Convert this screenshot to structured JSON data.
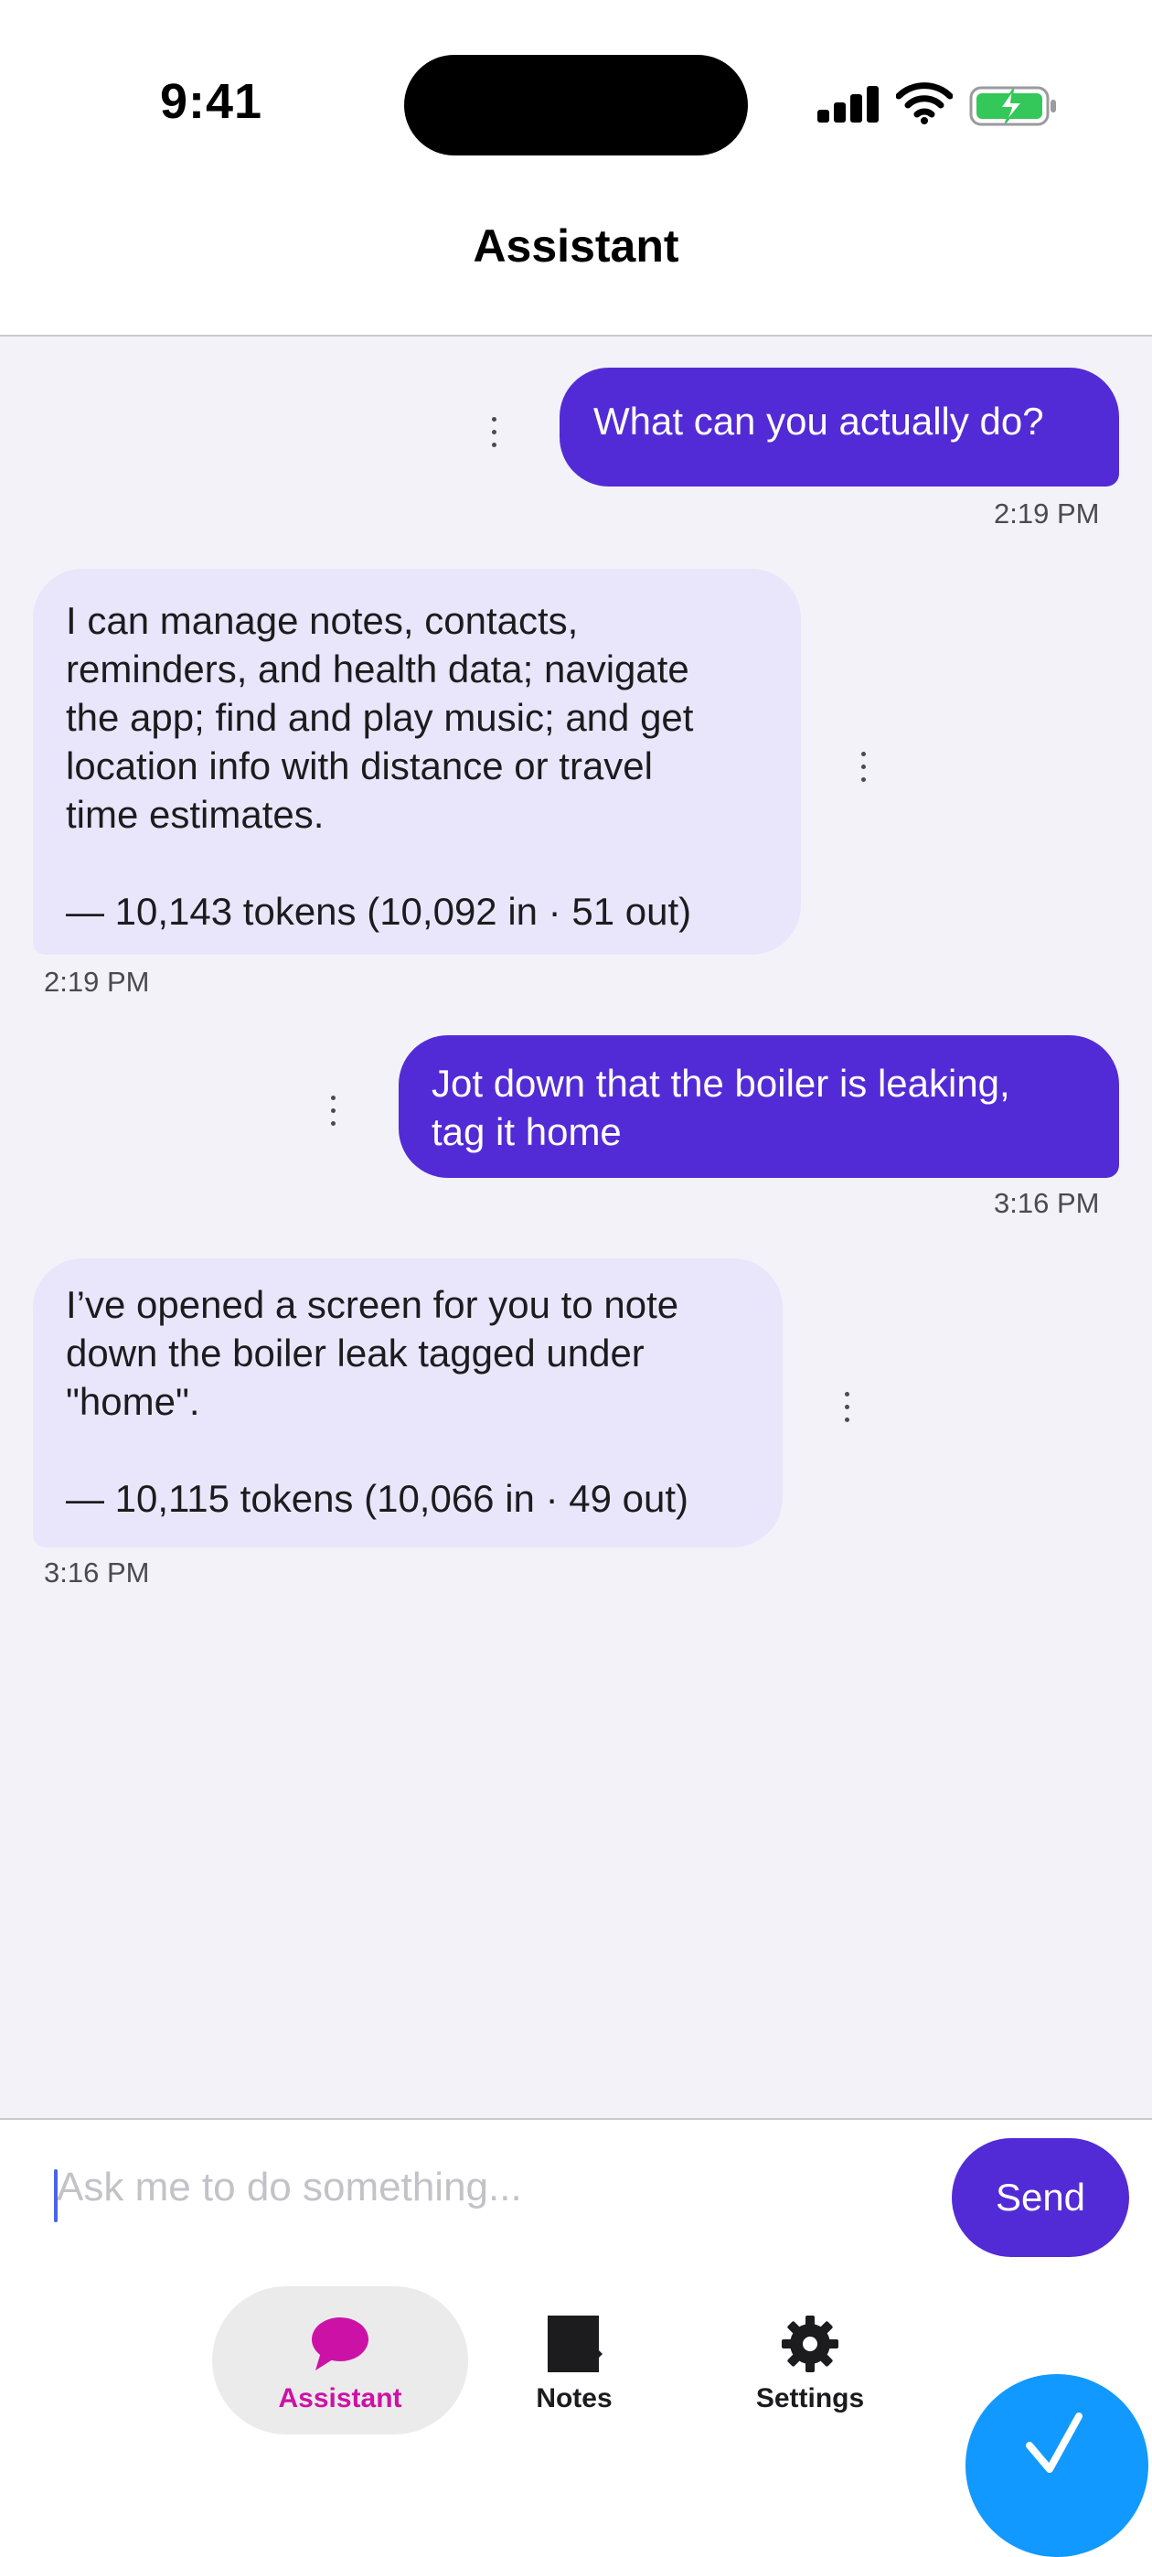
{
  "status_bar": {
    "time": "9:41"
  },
  "header": {
    "title": "Assistant"
  },
  "messages": [
    {
      "role": "user",
      "text": "What can you actually do?",
      "time": "2:19 PM"
    },
    {
      "role": "assistant",
      "text": "I can manage notes, contacts,\nreminders, and health data; navigate\nthe app; find and play music; and get\nlocation info with distance or travel\ntime estimates.\n\n— 10,143 tokens (10,092 in · 51 out)",
      "time": "2:19 PM"
    },
    {
      "role": "user",
      "text": "Jot down that the boiler is leaking,\ntag it home",
      "time": "3:16 PM"
    },
    {
      "role": "assistant",
      "text": "I’ve opened a screen for you to note\ndown the boiler leak tagged under\n\"home\".\n\n— 10,115 tokens (10,066 in · 49 out)",
      "time": "3:16 PM"
    }
  ],
  "composer": {
    "placeholder": "Ask me to do something...",
    "value": "",
    "send_label": "Send"
  },
  "tabs": [
    {
      "label": "Assistant",
      "icon": "chat-bubble-icon",
      "active": true
    },
    {
      "label": "Notes",
      "icon": "note-icon",
      "active": false
    },
    {
      "label": "Settings",
      "icon": "gear-icon",
      "active": false
    }
  ],
  "colors": {
    "accent": "#532bd6",
    "user_bubble": "#532bd6",
    "assistant_bubble": "#e9e6fb",
    "active_tab": "#cc12a6",
    "fab": "#1199ff",
    "chat_background": "#f3f2f8"
  }
}
